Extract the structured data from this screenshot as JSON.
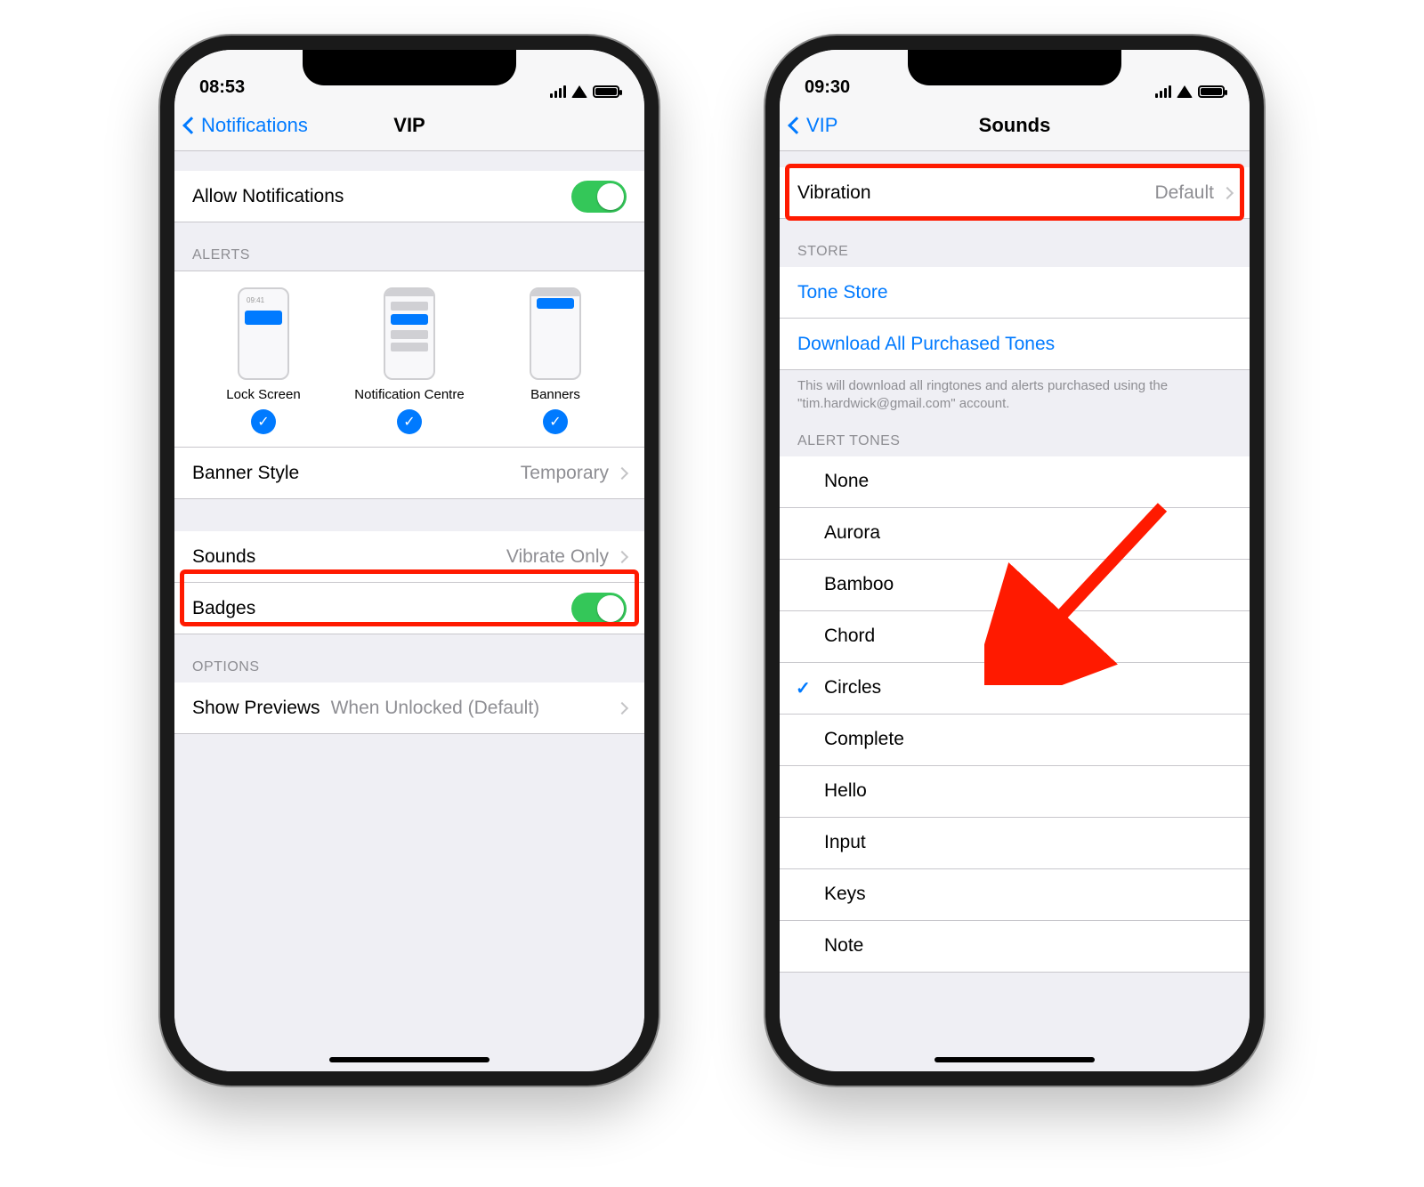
{
  "left": {
    "status_time": "08:53",
    "nav": {
      "back": "Notifications",
      "title": "VIP"
    },
    "allow_notifications": {
      "label": "Allow Notifications",
      "on": true
    },
    "alerts": {
      "header": "ALERTS",
      "options": [
        {
          "label": "Lock Screen"
        },
        {
          "label": "Notification Centre"
        },
        {
          "label": "Banners"
        }
      ],
      "banner_style": {
        "label": "Banner Style",
        "value": "Temporary"
      }
    },
    "sounds": {
      "label": "Sounds",
      "value": "Vibrate Only"
    },
    "badges": {
      "label": "Badges",
      "on": true
    },
    "options": {
      "header": "OPTIONS",
      "show_previews": {
        "label": "Show Previews",
        "value": "When Unlocked (Default)"
      }
    }
  },
  "right": {
    "status_time": "09:30",
    "nav": {
      "back": "VIP",
      "title": "Sounds"
    },
    "vibration": {
      "label": "Vibration",
      "value": "Default"
    },
    "store": {
      "header": "STORE",
      "tone_store": "Tone Store",
      "download_all": "Download All Purchased Tones",
      "footer": "This will download all ringtones and alerts purchased using the \"tim.hardwick@gmail.com\" account."
    },
    "alert_tones": {
      "header": "ALERT TONES",
      "items": [
        {
          "label": "None",
          "selected": false
        },
        {
          "label": "Aurora",
          "selected": false
        },
        {
          "label": "Bamboo",
          "selected": false
        },
        {
          "label": "Chord",
          "selected": false
        },
        {
          "label": "Circles",
          "selected": true
        },
        {
          "label": "Complete",
          "selected": false
        },
        {
          "label": "Hello",
          "selected": false
        },
        {
          "label": "Input",
          "selected": false
        },
        {
          "label": "Keys",
          "selected": false
        },
        {
          "label": "Note",
          "selected": false
        }
      ]
    }
  }
}
